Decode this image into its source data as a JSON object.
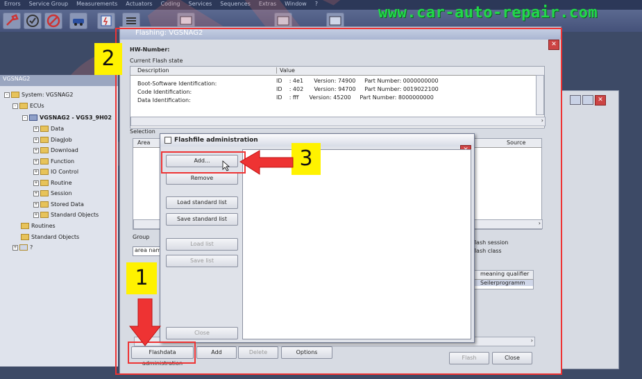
{
  "watermark": "www.car-auto-repair.com",
  "menubar": [
    "Errors",
    "Service Group",
    "Measurements",
    "Actuators",
    "Coding",
    "Services",
    "Sequences",
    "Extras",
    "Window",
    "?"
  ],
  "tree": {
    "window_title": "VGSNAG2",
    "nodes": [
      {
        "label": "System: VGSNAG2",
        "level": 0
      },
      {
        "label": "ECUs",
        "level": 1
      },
      {
        "label": "VGSNAG2 - VGS3_9H02",
        "level": 2
      },
      {
        "label": "Data",
        "level": 3
      },
      {
        "label": "DiagJob",
        "level": 3
      },
      {
        "label": "Download",
        "level": 3
      },
      {
        "label": "Function",
        "level": 3
      },
      {
        "label": "IO Control",
        "level": 3
      },
      {
        "label": "Routine",
        "level": 3
      },
      {
        "label": "Session",
        "level": 3
      },
      {
        "label": "Stored Data",
        "level": 3
      },
      {
        "label": "Standard Objects",
        "level": 3
      },
      {
        "label": "Routines",
        "level": 1
      },
      {
        "label": "Standard Objects",
        "level": 1
      },
      {
        "label": "?",
        "level": 0
      }
    ]
  },
  "flashing": {
    "title": "Flashing: VGSNAG2",
    "hw_number_label": "HW-Number:",
    "current_state_label": "Current Flash state",
    "columns": [
      "Description",
      "Value"
    ],
    "rows": [
      {
        "desc": "Boot-Software Identification:",
        "value": "ID    : 4e1      Version: 74900     Part Number: 0000000000"
      },
      {
        "desc": "Code Identification:",
        "value": "ID    : 402      Version: 94700     Part Number: 0019022100"
      },
      {
        "desc": "Data Identification:",
        "value": "ID    : fff      Version: 45200     Part Number: 8000000000"
      }
    ],
    "selection_label": "Selection",
    "selection_columns": [
      "Area",
      "Source"
    ],
    "group_label": "Group",
    "group_value": "area nam",
    "flash_session": "flash session",
    "flash_class": "flash class",
    "meaning_qualifier": "meaning qualifier",
    "meaning_value": "Seilerprogramm",
    "bottom_buttons": {
      "flashdata_admin": "Flashdata administration",
      "add": "Add",
      "delete": "Delete",
      "options": "Options",
      "flash": "Flash",
      "close": "Close"
    }
  },
  "file_admin": {
    "title": "Flashfile administration",
    "buttons": {
      "add": "Add...",
      "remove": "Remove",
      "load_standard": "Load standard list",
      "save_standard": "Save standard list",
      "load_list": "Load list",
      "save_list": "Save list",
      "close": "Close"
    }
  },
  "annotations": {
    "one": "1",
    "two": "2",
    "three": "3"
  },
  "colors": {
    "annotation_red": "#e33333",
    "annotation_yellow": "#fff200",
    "watermark_green": "#22d84a"
  }
}
